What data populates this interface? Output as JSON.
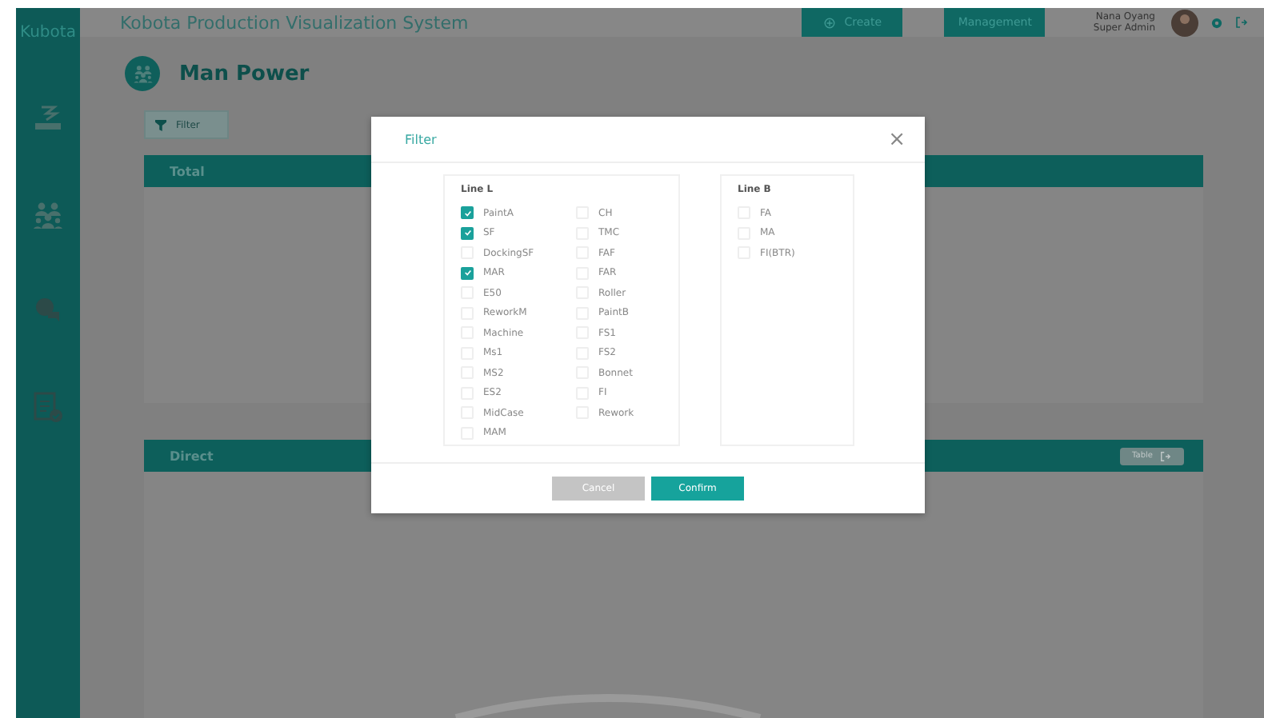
{
  "header": {
    "logo": "Kubota",
    "title": "Kobota Production Visualization System",
    "buttons": [
      {
        "kind": "create",
        "label": "Create"
      },
      {
        "kind": "plain",
        "label": "Management"
      }
    ],
    "user": {
      "name": "Nana Oyang",
      "role": "Super Admin"
    }
  },
  "page": {
    "title": "Man Power",
    "filter_button": "Filter"
  },
  "panels": [
    {
      "title": "Total"
    },
    {
      "title": "Direct",
      "button": "Table"
    }
  ],
  "dialog": {
    "title": "Filter",
    "close": "×",
    "groups": [
      {
        "title": "Line L",
        "items": [
          {
            "label": "PaintA",
            "checked": true
          },
          {
            "label": "SF",
            "checked": true
          },
          {
            "label": "DockingSF",
            "checked": false
          },
          {
            "label": "MAR",
            "checked": true
          },
          {
            "label": "E50",
            "checked": false
          },
          {
            "label": "ReworkM",
            "checked": false
          },
          {
            "label": "Machine",
            "checked": false
          },
          {
            "label": "Ms1",
            "checked": false
          },
          {
            "label": "MS2",
            "checked": false
          },
          {
            "label": "ES2",
            "checked": false
          },
          {
            "label": "MidCase",
            "checked": false
          },
          {
            "label": "MAM",
            "checked": false
          },
          {
            "label": "CH",
            "checked": false
          },
          {
            "label": "TMC",
            "checked": false
          },
          {
            "label": "FAF",
            "checked": false
          },
          {
            "label": "FAR",
            "checked": false
          },
          {
            "label": "Roller",
            "checked": false
          },
          {
            "label": "PaintB",
            "checked": false
          },
          {
            "label": "FS1",
            "checked": false
          },
          {
            "label": "FS2",
            "checked": false
          },
          {
            "label": "Bonnet",
            "checked": false
          },
          {
            "label": "FI",
            "checked": false
          },
          {
            "label": "Rework",
            "checked": false
          }
        ]
      },
      {
        "title": "Line B",
        "items": [
          {
            "label": "FA",
            "checked": false
          },
          {
            "label": "MA",
            "checked": false
          },
          {
            "label": "FI(BTR)",
            "checked": false
          }
        ]
      }
    ],
    "buttons": [
      {
        "kind": "cancel",
        "label": "Cancel"
      },
      {
        "kind": "confirm",
        "label": "Confirm"
      }
    ]
  }
}
